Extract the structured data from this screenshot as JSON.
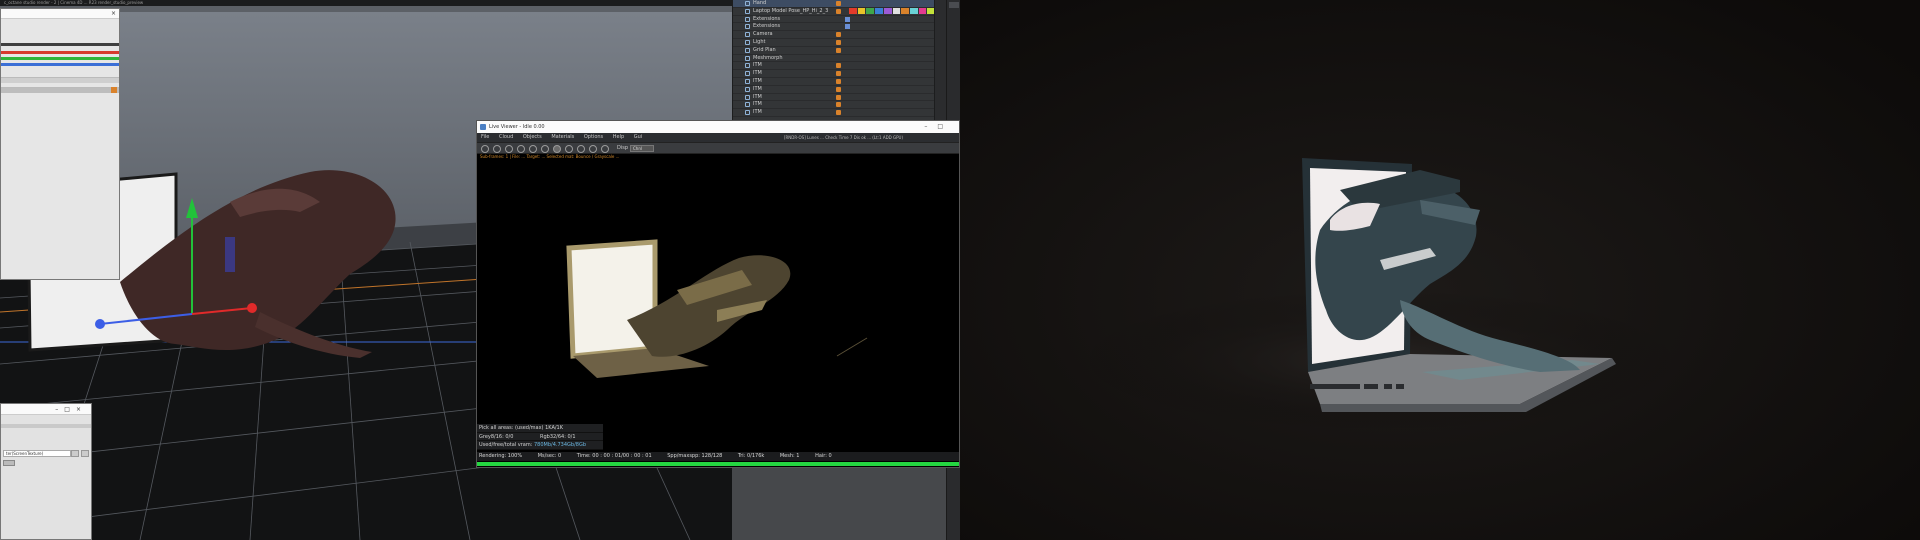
{
  "app": {
    "title": "c_octane studio render - 2 | Cinema 4D  ...  R23 render_studio_preview",
    "accent": "#d9822b",
    "selection_blue": "#3d4c63"
  },
  "object_manager": {
    "items": [
      {
        "label": "Hand",
        "selected": true
      },
      {
        "label": "Laptop Model Pose_HP_Hi_2_3"
      },
      {
        "label": "Extensions"
      },
      {
        "label": "Extensions"
      },
      {
        "label": "Camera"
      },
      {
        "label": "Light"
      },
      {
        "label": "Grid Plan"
      },
      {
        "label": "Meshmorph"
      },
      {
        "label": "ITM"
      },
      {
        "label": "ITM"
      },
      {
        "label": "ITM"
      },
      {
        "label": "ITM"
      },
      {
        "label": "ITM"
      },
      {
        "label": "ITM"
      },
      {
        "label": "ITM"
      }
    ]
  },
  "float_panel_2": {
    "field_value": "ter(ScreenTexture)"
  },
  "octane": {
    "window_title": "Live Viewer - Idle 0.00",
    "menu": [
      "File",
      "Cloud",
      "Objects",
      "Materials",
      "Options",
      "Help",
      "Gui"
    ],
    "info_text": "[RNDR-OS] Lunes ... Check Time 7 Dis ok  ... (Lt:1 ADD GPU)",
    "toolbar_label": "Disp",
    "toolbar_select": "Chnl",
    "path_text": "Sub-frames: 1 | File: ... Target: ... Selected mat: Bounce / Grayscale ...",
    "stats": [
      {
        "label": "Pick all areas: (used/max) 1KA/1K",
        "highlight": ""
      },
      {
        "label": "Grey8/16: 0/0",
        "value": "Rgb32/64: 0/1",
        "highlight": ""
      },
      {
        "label": "Used/free/total vram: ",
        "highlight": "780Mb/4.734Gb/8Gb"
      }
    ],
    "status": {
      "rendering_label": "Rendering: 100%",
      "ms_sec": "Ms/sec: 0",
      "time": "Time: 00 : 00 : 01/00 : 00 : 01",
      "spp": "Spp/maxspp: 128/128",
      "tri": "Tri: 0/176k",
      "mesh": "Mesh: 1",
      "hair": "Hair: 0"
    },
    "progress": 1.0,
    "progress_color": "#25d641"
  },
  "icons": [
    "close-icon",
    "minimize-icon",
    "maximize-icon",
    "move-axis-icon",
    "octane-render-icon"
  ]
}
